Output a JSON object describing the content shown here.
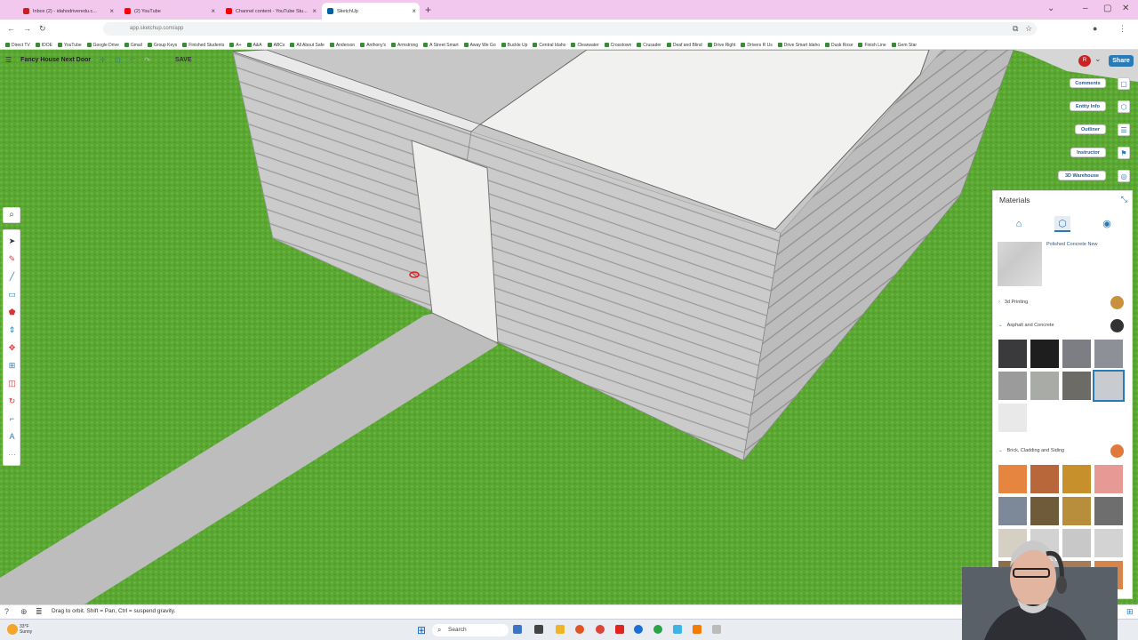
{
  "browser": {
    "tabs": [
      {
        "title": "Inbox (2) - idahodriveredu.c...",
        "color": "#c5221f",
        "active": false
      },
      {
        "title": "(2) YouTube",
        "color": "#ff0000",
        "active": false
      },
      {
        "title": "Channel content - YouTube Stu...",
        "color": "#ff0000",
        "active": false
      },
      {
        "title": "SketchUp",
        "color": "#005f9e",
        "active": true
      }
    ],
    "url": "app.sketchup.com/app",
    "bookmarks": [
      "Direct TV",
      "IDOE",
      "YouTube",
      "Google Drive",
      "Gmail",
      "Group Keys",
      "Finished Students",
      "A+",
      "A&A",
      "ABCs",
      "All About Safe",
      "Anderson",
      "Anthony's",
      "Armstrong",
      "A Street Smart",
      "Away We Go",
      "Buckle Up",
      "Central Idaho",
      "Clearwater",
      "Crosstown",
      "Crusader",
      "Deaf and Blind",
      "Drive Right",
      "Drivers R Us",
      "Drive Smart Idaho",
      "Dusk Rose",
      "Finish Line",
      "Gem Star"
    ]
  },
  "app": {
    "model_title": "Fancy House Next Door",
    "save_label": "SAVE",
    "share_label": "Share",
    "side_panels": [
      "Comments",
      "Entity Info",
      "Outliner",
      "Instructor",
      "3D Warehouse"
    ]
  },
  "materials": {
    "title": "Materials",
    "current_material": "Polished Concrete New",
    "categories": [
      {
        "name": "3d Printing",
        "dot_color": "#c8913e"
      },
      {
        "name": "Asphalt and Concrete",
        "dot_color": "#333333"
      },
      {
        "name": "Brick, Cladding and Siding",
        "dot_color": "#e07a3a"
      }
    ],
    "asphalt_swatches": [
      "#3a3a3c",
      "#1e1e1f",
      "#7c7e83",
      "#8d9096",
      "#9b9b9b",
      "#a9aba7",
      "#6d6b65",
      "#c8ccd1",
      "#e9e9e9"
    ],
    "brick_swatches": [
      "#e5853f",
      "#b8673b",
      "#c8902a",
      "#e79a95",
      "#7d8898",
      "#6f5b3a",
      "#b88d3c",
      "#6e6e6e",
      "#d6cfc3",
      "#d2d2d2",
      "#c8c8c8",
      "#d3d3d3",
      "#8d6e4a",
      "#bdbdbd",
      "#a77a5a",
      "#d7834a"
    ]
  },
  "status": {
    "hint": "Drag to orbit. Shift = Pan, Ctrl = suspend gravity."
  },
  "taskbar": {
    "search_label": "Search",
    "weather_temp": "33°F",
    "weather_desc": "Sunny"
  },
  "scene": {
    "grass_color": "#5aa832",
    "wall_color": "#c9c9c9",
    "roof_color": "#efefed",
    "sidewalk_color": "#bdbdbd"
  }
}
